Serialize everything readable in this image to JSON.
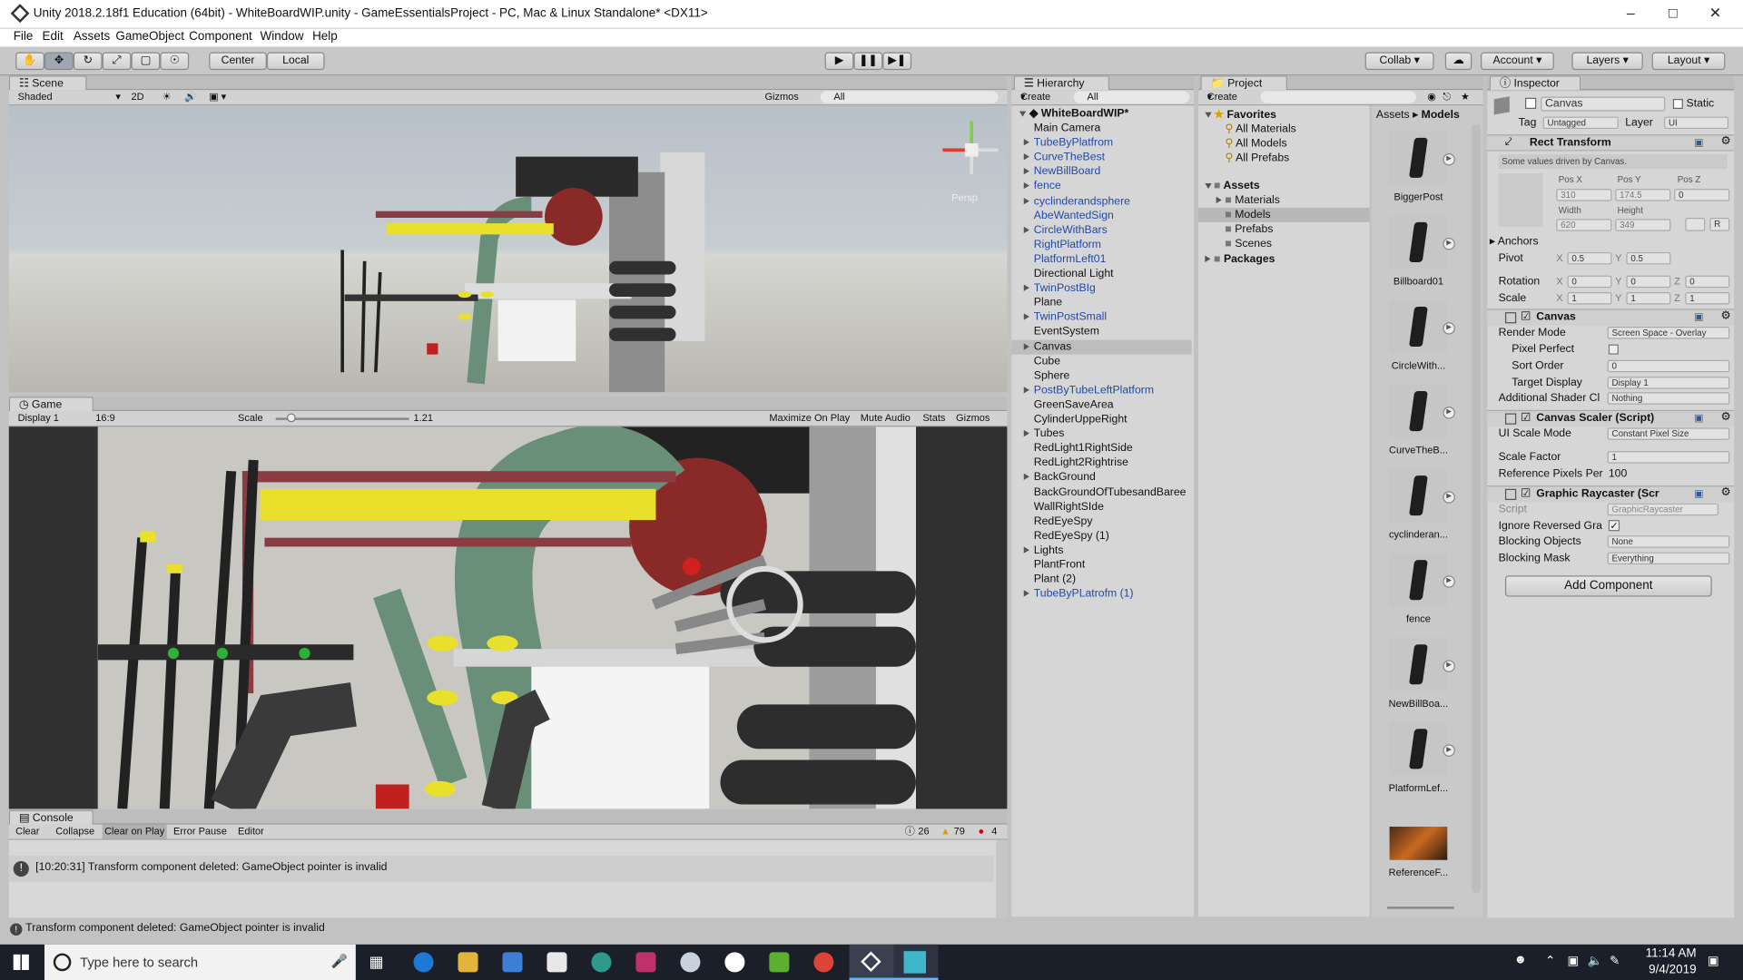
{
  "window": {
    "title": "Unity 2018.2.18f1 Education (64bit) - WhiteBoardWIP.unity - GameEssentialsProject - PC, Mac & Linux Standalone* <DX11>"
  },
  "menu": [
    "File",
    "Edit",
    "Assets",
    "GameObject",
    "Component",
    "Window",
    "Help"
  ],
  "toolbar": {
    "center": "Center",
    "local": "Local",
    "collab": "Collab",
    "account": "Account",
    "layers": "Layers",
    "layout": "Layout"
  },
  "scene": {
    "tab": "Scene",
    "shade": "Shaded",
    "mode2d": "2D",
    "gizmos": "Gizmos",
    "search": "All",
    "persp": "Persp"
  },
  "game": {
    "tab": "Game",
    "display": "Display 1",
    "aspect": "16:9",
    "scale_label": "Scale",
    "scale_value": "1.21",
    "maximize": "Maximize On Play",
    "mute": "Mute Audio",
    "stats": "Stats",
    "gizmos": "Gizmos"
  },
  "hierarchy": {
    "tab": "Hierarchy",
    "create": "Create",
    "search": "All",
    "scene": "WhiteBoardWIP*",
    "items": [
      {
        "label": "Main Camera",
        "prefab": false,
        "expand": false
      },
      {
        "label": "TubeByPlatfrom",
        "prefab": true,
        "expand": true
      },
      {
        "label": "CurveTheBest",
        "prefab": true,
        "expand": true
      },
      {
        "label": "NewBillBoard",
        "prefab": true,
        "expand": true
      },
      {
        "label": "fence",
        "prefab": true,
        "expand": true
      },
      {
        "label": "cyclinderandsphere",
        "prefab": true,
        "expand": true
      },
      {
        "label": "AbeWantedSign",
        "prefab": true,
        "expand": false
      },
      {
        "label": "CircleWithBars",
        "prefab": true,
        "expand": true
      },
      {
        "label": "RightPlatform",
        "prefab": true,
        "expand": false
      },
      {
        "label": "PlatformLeft01",
        "prefab": true,
        "expand": false
      },
      {
        "label": "Directional Light",
        "prefab": false,
        "expand": false
      },
      {
        "label": "TwinPostBIg",
        "prefab": true,
        "expand": true
      },
      {
        "label": "Plane",
        "prefab": false,
        "expand": false
      },
      {
        "label": "TwinPostSmall",
        "prefab": true,
        "expand": true
      },
      {
        "label": "EventSystem",
        "prefab": false,
        "expand": false
      },
      {
        "label": "Canvas",
        "prefab": false,
        "expand": true,
        "selected": true
      },
      {
        "label": "Cube",
        "prefab": false,
        "expand": false
      },
      {
        "label": "Sphere",
        "prefab": false,
        "expand": false
      },
      {
        "label": "PostByTubeLeftPlatform",
        "prefab": true,
        "expand": true
      },
      {
        "label": "GreenSaveArea",
        "prefab": false,
        "expand": false
      },
      {
        "label": "CylinderUppeRight",
        "prefab": false,
        "expand": false
      },
      {
        "label": "Tubes",
        "prefab": false,
        "expand": true
      },
      {
        "label": "RedLight1RightSide",
        "prefab": false,
        "expand": false
      },
      {
        "label": "RedLight2Rightrise",
        "prefab": false,
        "expand": false
      },
      {
        "label": "BackGround",
        "prefab": false,
        "expand": true
      },
      {
        "label": "BackGroundOfTubesandBaree",
        "prefab": false,
        "expand": false
      },
      {
        "label": "WallRightSIde",
        "prefab": false,
        "expand": false
      },
      {
        "label": "RedEyeSpy",
        "prefab": false,
        "expand": false
      },
      {
        "label": "RedEyeSpy (1)",
        "prefab": false,
        "expand": false
      },
      {
        "label": "Lights",
        "prefab": false,
        "expand": true
      },
      {
        "label": "PlantFront",
        "prefab": false,
        "expand": false
      },
      {
        "label": "Plant (2)",
        "prefab": false,
        "expand": false
      },
      {
        "label": "TubeByPLatrofm (1)",
        "prefab": true,
        "expand": true
      }
    ]
  },
  "project": {
    "tab": "Project",
    "create": "Create",
    "favorites": "Favorites",
    "fav_items": [
      "All Materials",
      "All Models",
      "All Prefabs"
    ],
    "assets": "Assets",
    "asset_items": [
      "Materials",
      "Models",
      "Prefabs",
      "Scenes"
    ],
    "packages": "Packages",
    "breadcrumb": [
      "Assets",
      "Models"
    ],
    "thumbs": [
      "BiggerPost",
      "Billboard01",
      "CircleWith...",
      "CurveTheB...",
      "cyclinderan...",
      "fence",
      "NewBillBoa...",
      "PlatformLef...",
      "ReferenceF..."
    ]
  },
  "inspector": {
    "tab": "Inspector",
    "object": "Canvas",
    "static": "Static",
    "tag_label": "Tag",
    "tag": "Untagged",
    "layer_label": "Layer",
    "layer": "UI",
    "rect": {
      "title": "Rect Transform",
      "note": "Some values driven by Canvas.",
      "posx_l": "Pos X",
      "posy_l": "Pos Y",
      "posz_l": "Pos Z",
      "posx": "310",
      "posy": "174.5",
      "posz": "0",
      "width_l": "Width",
      "height_l": "Height",
      "width": "620",
      "height": "349",
      "anchors": "Anchors",
      "pivot": "Pivot",
      "pivot_x": "0.5",
      "pivot_y": "0.5",
      "rotation": "Rotation",
      "rot_x": "0",
      "rot_y": "0",
      "rot_z": "0",
      "scale": "Scale",
      "sc_x": "1",
      "sc_y": "1",
      "sc_z": "1"
    },
    "canvas": {
      "title": "Canvas",
      "render_mode_l": "Render Mode",
      "render_mode": "Screen Space - Overlay",
      "pixel_perfect_l": "Pixel Perfect",
      "sort_order_l": "Sort Order",
      "sort_order": "0",
      "target_display_l": "Target Display",
      "target_display": "Display 1",
      "shader_l": "Additional Shader Cl",
      "shader": "Nothing"
    },
    "scaler": {
      "title": "Canvas Scaler (Script)",
      "mode_l": "UI Scale Mode",
      "mode": "Constant Pixel Size",
      "factor_l": "Scale Factor",
      "factor": "1",
      "ref_l": "Reference Pixels Per",
      "ref": "100"
    },
    "raycaster": {
      "title": "Graphic Raycaster (Scr",
      "script_l": "Script",
      "script": "GraphicRaycaster",
      "ignore_l": "Ignore Reversed Gra",
      "blocking_l": "Blocking Objects",
      "blocking": "None",
      "mask_l": "Blocking Mask",
      "mask": "Everything"
    },
    "add_component": "Add Component"
  },
  "console": {
    "tab": "Console",
    "clear": "Clear",
    "collapse": "Collapse",
    "clear_on_play": "Clear on Play",
    "error_pause": "Error Pause",
    "editor": "Editor",
    "count_info": "26",
    "count_warn": "79",
    "count_err": "4",
    "message": "[10:20:31] Transform component deleted: GameObject pointer is invalid"
  },
  "statusbar": {
    "message": "Transform component deleted: GameObject pointer is invalid"
  },
  "taskbar": {
    "search": "Type here to search",
    "time": "11:14 AM",
    "date": "9/4/2019"
  },
  "colors": {
    "prefab": "#2149a8",
    "yellow": "#e8e02a",
    "green_tube": "#6a8f78",
    "red": "#a8282a",
    "selection": "#3d6db5"
  }
}
